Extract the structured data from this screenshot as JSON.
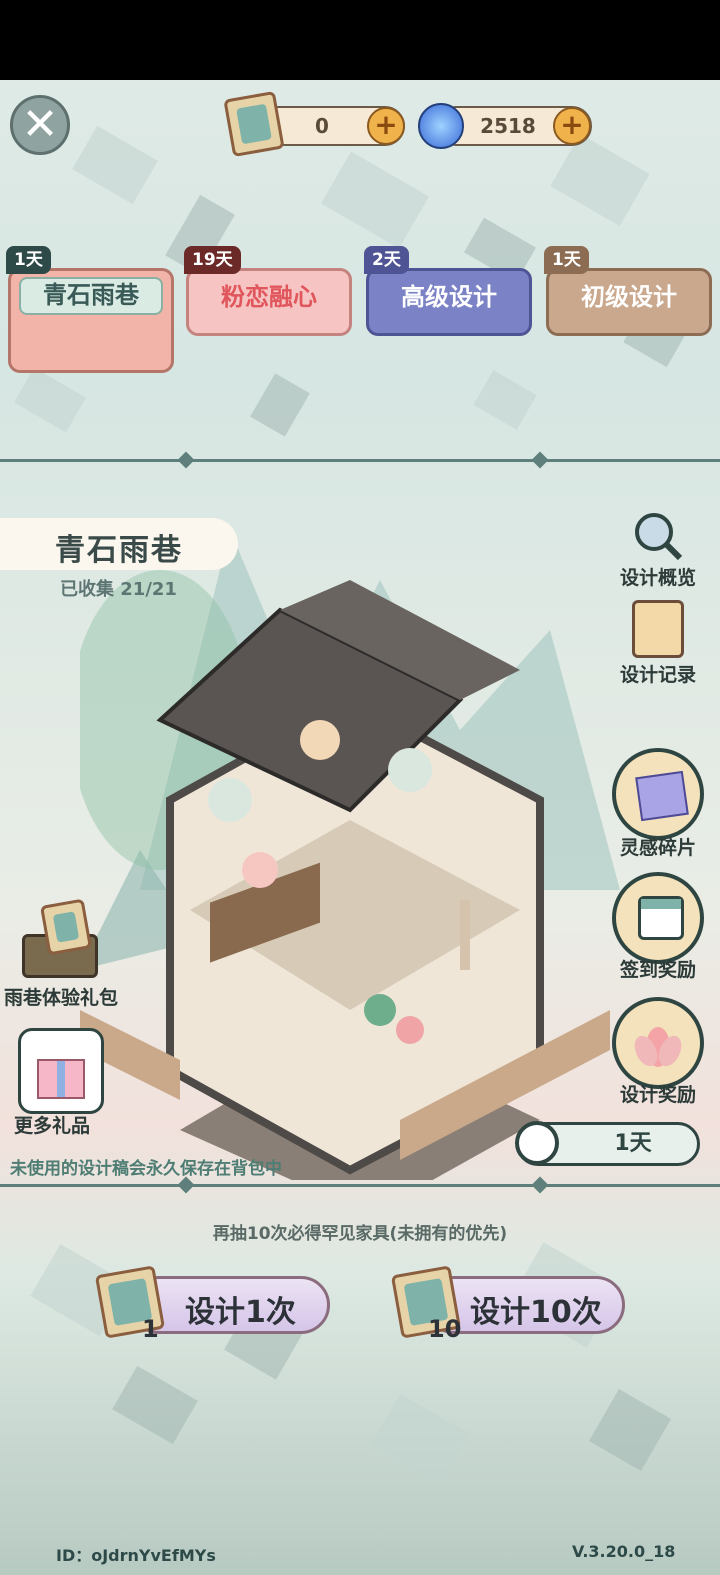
{
  "currencies": [
    {
      "name": "design-draft-ticket",
      "value": "0"
    },
    {
      "name": "inspiration-orb",
      "value": "2518"
    }
  ],
  "tabs": [
    {
      "days": "1天",
      "label": "青石雨巷",
      "bg": "#f2b4a8",
      "fg": "#3a5a58"
    },
    {
      "days": "19天",
      "label": "粉恋融心",
      "bg": "#f6c5c3",
      "fg": "#e0565c"
    },
    {
      "days": "2天",
      "label": "高级设计",
      "bg": "#7b83c6",
      "fg": "#ffffff"
    },
    {
      "days": "1天",
      "label": "初级设计",
      "bg": "#c9a88d",
      "fg": "#ffffff"
    }
  ],
  "set": {
    "title": "青石雨巷",
    "collected": "已收集 21/21"
  },
  "right_menu": {
    "overview": "设计概览",
    "records": "设计记录",
    "fragments": "灵感碎片",
    "checkin": "签到奖励",
    "rewards": "设计奖励"
  },
  "left_menu": {
    "gift_pack": "雨巷体验礼包",
    "more_gifts": "更多礼品"
  },
  "timer": "1天",
  "notice": "未使用的设计稿会永久保存在背包中",
  "guarantee": "再抽10次必得罕见家具(未拥有的优先)",
  "draw_buttons": [
    {
      "label": "设计1次",
      "cost": "1"
    },
    {
      "label": "设计10次",
      "cost": "10"
    }
  ],
  "footer": {
    "id": "ID：oJdrnYvEfMYs",
    "version": "V.3.20.0_18"
  },
  "colors": {
    "accent_teal": "#5e7f7b",
    "gold": "#f0b24a"
  }
}
